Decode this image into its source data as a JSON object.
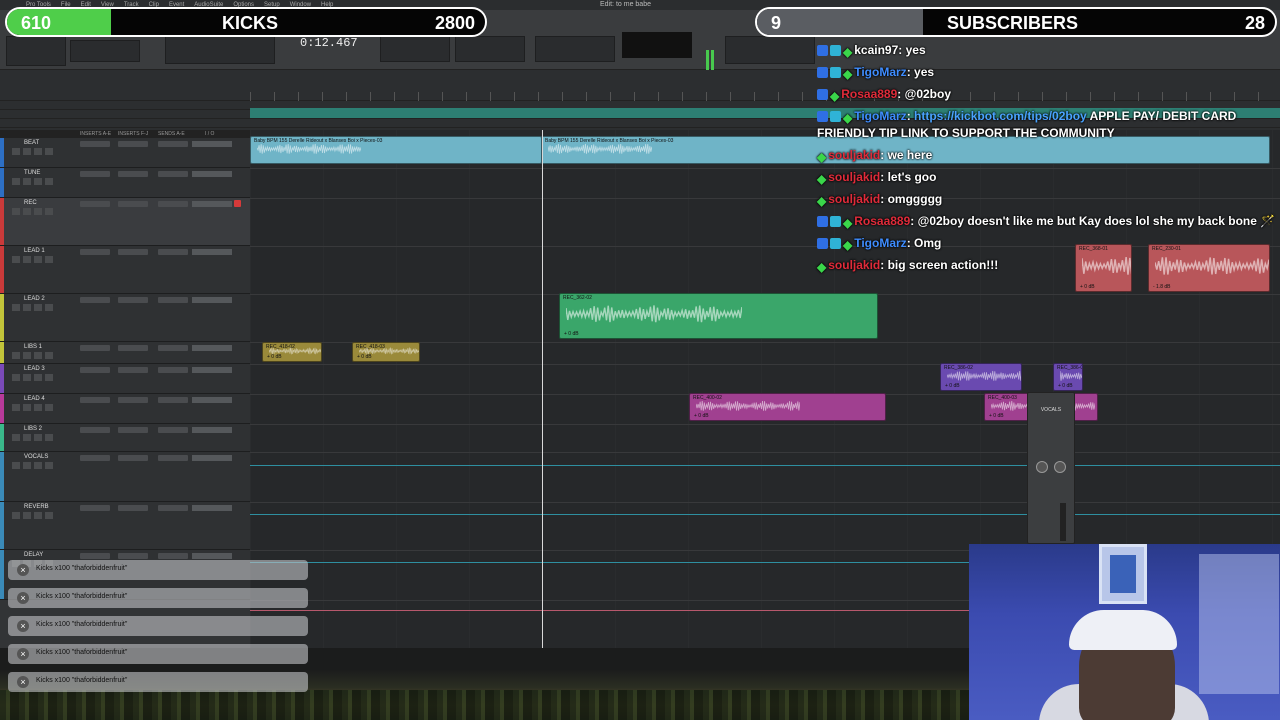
{
  "app": {
    "menu": [
      "Pro Tools",
      "File",
      "Edit",
      "View",
      "Track",
      "Clip",
      "Event",
      "AudioSuite",
      "Options",
      "Setup",
      "Window",
      "Help"
    ],
    "window_title": "Edit: to me babe",
    "counter": "0:12.467"
  },
  "overlays": {
    "kicks": {
      "count": "610",
      "label": "KICKS",
      "goal": "2800",
      "fill_fraction": 0.218,
      "color": "#4fce4a"
    },
    "subscribers": {
      "count": "9",
      "label": "SUBSCRIBERS",
      "goal": "28",
      "fill_fraction": 0.321,
      "color": "#5a5d62"
    }
  },
  "tracks": {
    "column_headers": [
      "INSERTS A-E",
      "INSERTS F-J",
      "SENDS A-E",
      "I / O"
    ],
    "items": [
      {
        "name": "BEAT",
        "color": "#2d6fc4"
      },
      {
        "name": "TUNE",
        "color": "#2d6fc4"
      },
      {
        "name": "REC",
        "color": "#c93a3a",
        "selected": true
      },
      {
        "name": "LEAD 1",
        "color": "#c93a3a"
      },
      {
        "name": "LEAD 2",
        "color": "#c2c43a"
      },
      {
        "name": "LIBS 1",
        "color": "#c2c43a"
      },
      {
        "name": "LEAD 3",
        "color": "#7a4ab8"
      },
      {
        "name": "LEAD 4",
        "color": "#b83a9a"
      },
      {
        "name": "LIBS 2",
        "color": "#3ab88a"
      },
      {
        "name": "VOCALS",
        "color": "#3a8ab8"
      },
      {
        "name": "REVERB",
        "color": "#3a8ab8"
      },
      {
        "name": "DELAY",
        "color": "#3a8ab8"
      }
    ]
  },
  "clips": [
    {
      "name": "Baby BPM 155 Derelle Rideout x Blanses Boi x Pieces-03",
      "color": "#6fb4c7",
      "db": ""
    },
    {
      "name": "Baby BPM 155 Derelle Rideout x Blanses Boi x Pieces-03",
      "color": "#6fb4c7",
      "db": ""
    },
    {
      "name": "REC_362-02",
      "color": "#3aa66a",
      "db": "+ 0 dB"
    },
    {
      "name": "REC_418-02",
      "color": "#9a8a3a",
      "db": "+ 0 dB"
    },
    {
      "name": "REC_418-03",
      "color": "#9a8a3a",
      "db": "+ 0 dB"
    },
    {
      "name": "REC_368-01",
      "color": "#b8565a",
      "db": "+ 0 dB"
    },
    {
      "name": "REC_230-01",
      "color": "#b8565a",
      "db": "- 1.8 dB"
    },
    {
      "name": "REC_386-02",
      "color": "#6a4ab0",
      "db": "+ 0 dB"
    },
    {
      "name": "REC_386-02",
      "color": "#6a4ab0",
      "db": "+ 0 dB"
    },
    {
      "name": "REC_400-02",
      "color": "#a04090",
      "db": "+ 0 dB"
    },
    {
      "name": "REC_400-03",
      "color": "#a04090",
      "db": "+ 0 dB"
    }
  ],
  "mini_mixer": {
    "label": "VOCALS"
  },
  "chat": [
    {
      "user": "kcain97",
      "user_color": "#ffffff",
      "badges": [
        "mod",
        "sub",
        "og"
      ],
      "text": ": yes"
    },
    {
      "user": "TigoMarz",
      "user_color": "#3f8dff",
      "badges": [
        "mod",
        "sub",
        "og"
      ],
      "text": ": yes"
    },
    {
      "user": "Rosaa889",
      "user_color": "#e02b3a",
      "badges": [
        "mod",
        "og"
      ],
      "text": ": @02boy"
    },
    {
      "user": "TigoMarz",
      "user_color": "#3f8dff",
      "badges": [
        "mod",
        "sub",
        "og"
      ],
      "link": "https://kickbot.com/tips/02boy",
      "text": " APPLE PAY/ DEBIT CARD"
    },
    {
      "user": "",
      "user_color": "#ffffff",
      "badges": [],
      "text": "FRIENDLY TIP LINK TO SUPPORT THE COMMUNITY"
    },
    {
      "user": "souljakid",
      "user_color": "#e02b3a",
      "badges": [
        "og"
      ],
      "text": ": we here"
    },
    {
      "user": "souljakid",
      "user_color": "#e02b3a",
      "badges": [
        "og"
      ],
      "text": ": let's goo"
    },
    {
      "user": "souljakid",
      "user_color": "#e02b3a",
      "badges": [
        "og"
      ],
      "text": ": omggggg"
    },
    {
      "user": "Rosaa889",
      "user_color": "#e02b3a",
      "badges": [
        "mod",
        "sub",
        "og"
      ],
      "text": ": @02boy doesn't like me but Kay does lol she my back bone 🪄"
    },
    {
      "user": "TigoMarz",
      "user_color": "#3f8dff",
      "badges": [
        "mod",
        "sub",
        "og"
      ],
      "text": ": Omg"
    },
    {
      "user": "souljakid",
      "user_color": "#e02b3a",
      "badges": [
        "og"
      ],
      "text": ": big screen action!!!"
    }
  ],
  "alerts": [
    {
      "text": "Kicks x100 \"thaforbiddenfruit\""
    },
    {
      "text": "Kicks x100 \"thaforbiddenfruit\""
    },
    {
      "text": "Kicks x100 \"thaforbiddenfruit\""
    },
    {
      "text": "Kicks x100 \"thaforbiddenfruit\""
    },
    {
      "text": "Kicks x100 \"thaforbiddenfruit\""
    }
  ]
}
